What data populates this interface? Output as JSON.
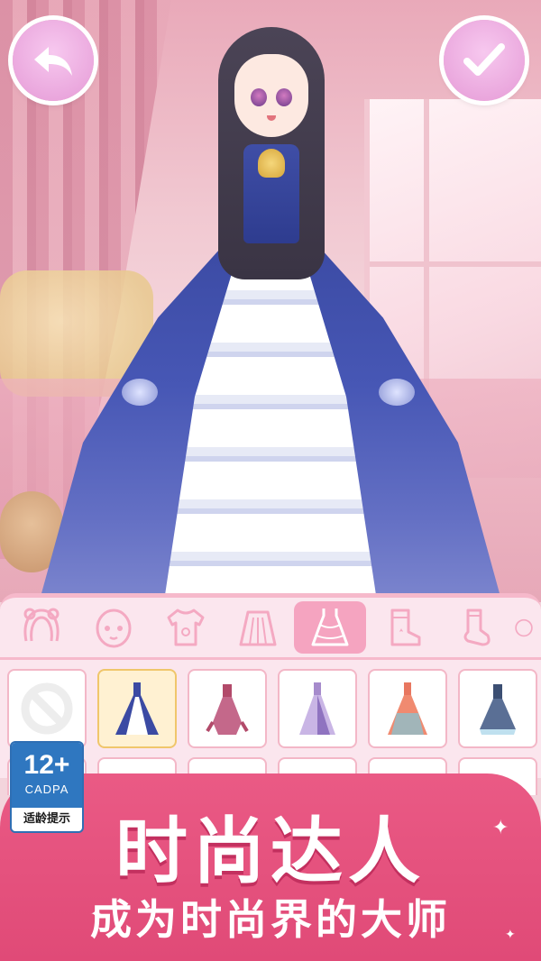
{
  "header": {
    "back_icon": "undo-arrow-icon",
    "confirm_icon": "checkmark-icon",
    "button_color": "#e59ad6"
  },
  "wardrobe": {
    "tabs": [
      {
        "icon": "hair-icon",
        "active": false
      },
      {
        "icon": "face-icon",
        "active": false
      },
      {
        "icon": "shirt-icon",
        "active": false
      },
      {
        "icon": "skirt-icon",
        "active": false
      },
      {
        "icon": "dress-icon",
        "active": true
      },
      {
        "icon": "boots-icon",
        "active": false
      },
      {
        "icon": "sock-icon",
        "active": false
      }
    ],
    "items": [
      {
        "icon": "none-prohibited-icon"
      },
      {
        "icon": "blue-ballgown-icon",
        "selected": true
      },
      {
        "icon": "red-dress-icon"
      },
      {
        "icon": "lavender-gown-icon"
      },
      {
        "icon": "coral-gown-icon"
      },
      {
        "icon": "navy-dress-icon"
      }
    ]
  },
  "age_rating": {
    "age": "12+",
    "org": "CADPA",
    "note": "适龄提示"
  },
  "banner": {
    "title": "时尚达人",
    "subtitle": "成为时尚界的大师",
    "color": "#e04a77"
  }
}
